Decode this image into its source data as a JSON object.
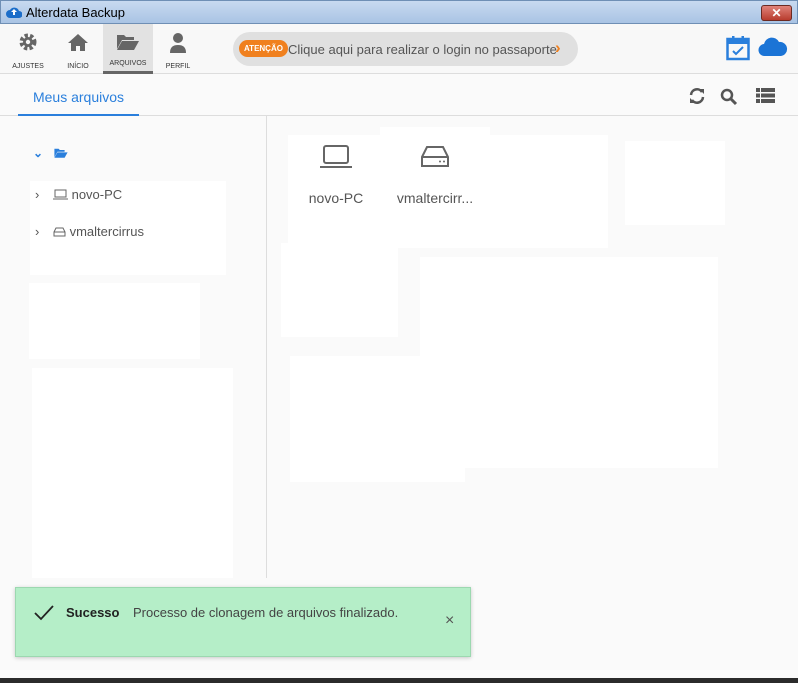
{
  "window": {
    "title": "Alterdata Backup",
    "close": "✕"
  },
  "toolbar": {
    "items": [
      {
        "label": "AJUSTES"
      },
      {
        "label": "INÍCIO"
      },
      {
        "label": "ARQUIVOS"
      },
      {
        "label": "PERFIL"
      }
    ],
    "banner": {
      "badge": "ATENÇÃO",
      "text": "Clique aqui para realizar o login no passaporte",
      "arrow": "›"
    }
  },
  "tabs": [
    {
      "label": "Meus arquivos"
    }
  ],
  "tree": {
    "items": [
      {
        "label": "novo-PC"
      },
      {
        "label": "vmaltercirrus"
      }
    ]
  },
  "grid": {
    "items": [
      {
        "label": "novo-PC"
      },
      {
        "label": "vmaltercirr..."
      }
    ]
  },
  "toast": {
    "title": "Sucesso",
    "message": "Processo de clonagem de arquivos finalizado.",
    "close": "×"
  },
  "colors": {
    "accent": "#2a7fdc",
    "badge": "#f0801e",
    "toast": "#b5eec8"
  }
}
